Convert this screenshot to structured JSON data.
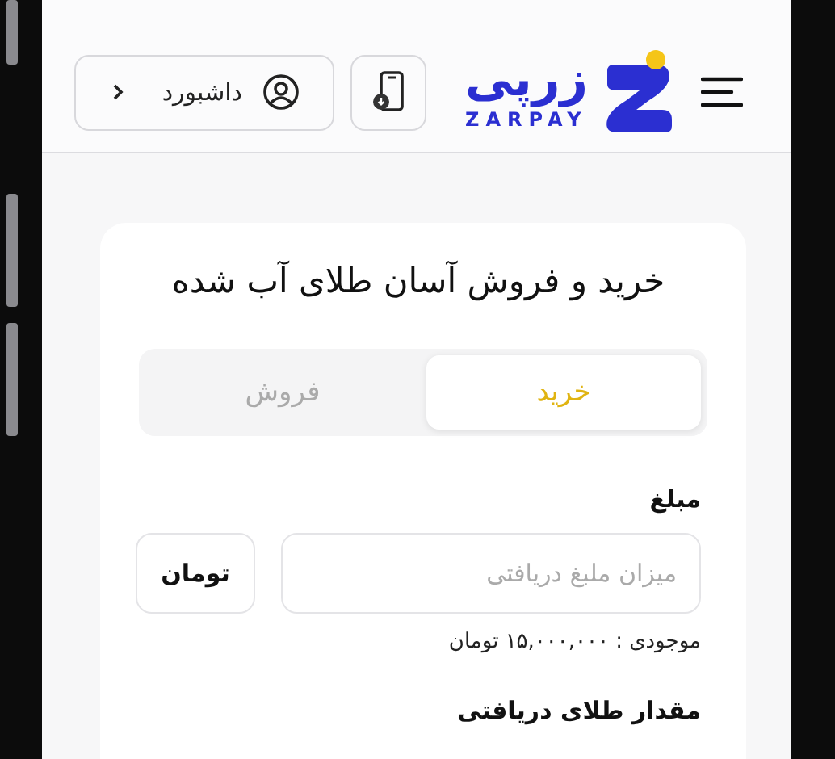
{
  "header": {
    "logo": {
      "name": "زرپی",
      "latin": "ZARPAY"
    },
    "dashboard_button": {
      "label": "داشبورد"
    }
  },
  "card": {
    "title": "خرید و فروش آسان طلای آب شده",
    "tabs": [
      {
        "label": "خرید",
        "selected": true
      },
      {
        "label": "فروش",
        "selected": false
      }
    ],
    "amount_field": {
      "label": "مبلغ",
      "placeholder": "میزان ملبغ دریافتی",
      "unit": "تومان",
      "balance": "موجودی : ۱۵,۰۰۰,۰۰۰ تومان"
    },
    "gold_field": {
      "label": "مقدار طلای دریافتی"
    }
  }
}
